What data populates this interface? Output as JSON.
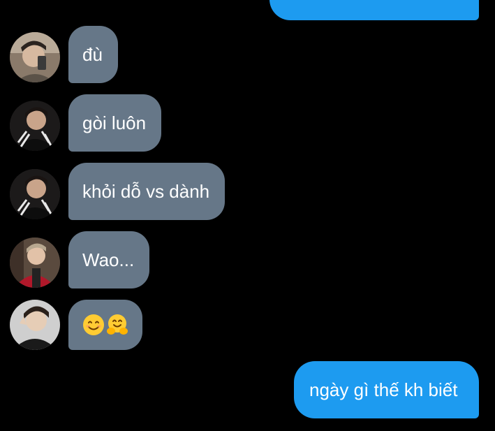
{
  "conversation": {
    "messages": [
      {
        "sender": "me",
        "text": ""
      },
      {
        "sender": "user-1",
        "text": "đù"
      },
      {
        "sender": "user-2",
        "text": "gòi luôn"
      },
      {
        "sender": "user-2",
        "text": "khỏi dỗ vs dành"
      },
      {
        "sender": "user-3",
        "text": "Wao..."
      },
      {
        "sender": "user-4",
        "emojis": [
          "smiling-face-icon",
          "hugging-face-icon"
        ]
      },
      {
        "sender": "me",
        "text": "ngày gì thế kh biết"
      }
    ]
  },
  "colors": {
    "background": "#000000",
    "incoming_bubble": "#667788",
    "outgoing_bubble": "#1d9bf0",
    "text": "#ffffff"
  }
}
